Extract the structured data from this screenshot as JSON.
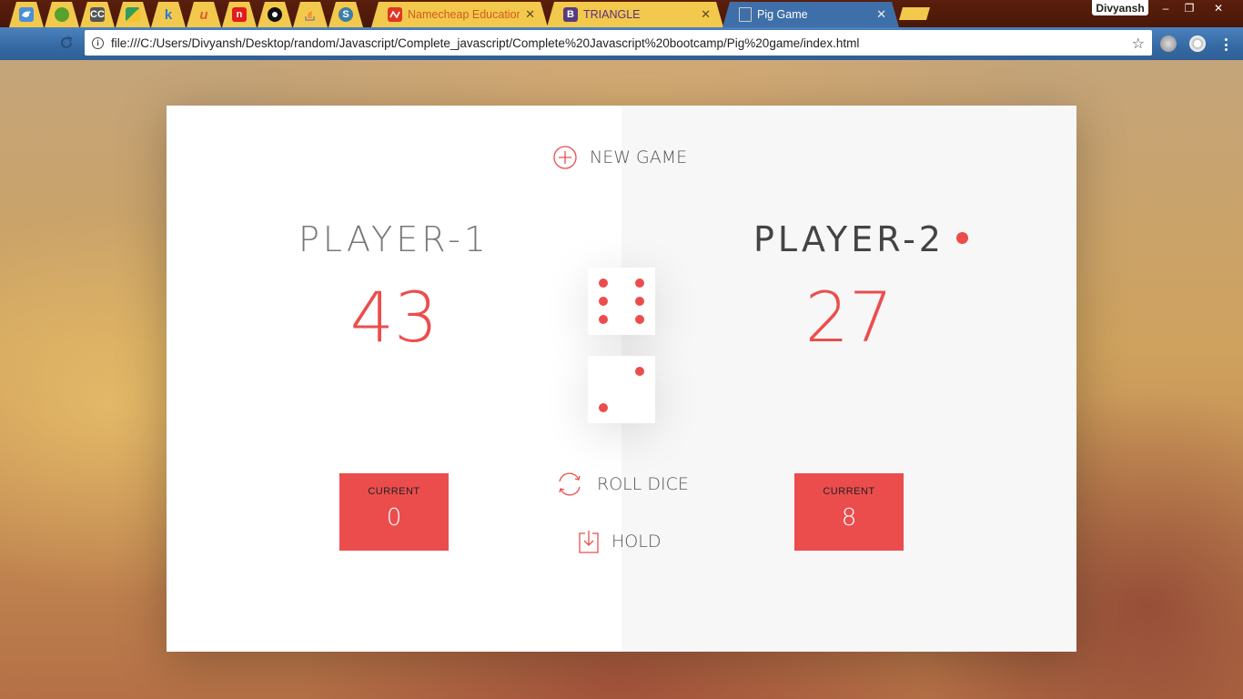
{
  "browser": {
    "tabs": [
      {
        "icon": "bird-icon",
        "color": "#4a90d9",
        "label": ""
      },
      {
        "icon": "cube-icon",
        "color": "#5aa02c",
        "label": ""
      },
      {
        "icon": "cc-icon",
        "color": "#555555",
        "label": "CC"
      },
      {
        "icon": "drive-icon",
        "color": "#2f9e5c",
        "label": ""
      },
      {
        "icon": "k-icon",
        "color": "#2a7bd8",
        "label": "k"
      },
      {
        "icon": "u-icon",
        "color": "#e25b2c",
        "label": "u"
      },
      {
        "icon": "n-icon",
        "color": "#e21b1b",
        "label": "n"
      },
      {
        "icon": "github-icon",
        "color": "#111111",
        "label": ""
      },
      {
        "icon": "stackoverflow-icon",
        "color": "#f48024",
        "label": ""
      },
      {
        "icon": "s-icon",
        "color": "#3b7ea8",
        "label": "S"
      },
      {
        "icon": "namecheap-icon",
        "color": "#de3723",
        "label": "Namecheap Education P"
      },
      {
        "icon": "bootstrap-icon",
        "color": "#563d7c",
        "label": "TRIANGLE"
      },
      {
        "icon": "page-icon",
        "color": "#dddddd",
        "label": "Pig Game"
      }
    ],
    "profile_name": "Divyansh",
    "window_buttons": [
      "–",
      "❐",
      "✕"
    ],
    "url": "file:///C:/Users/Divyansh/Desktop/random/Javascript/Complete_javascript/Complete%20Javascript%20bootcamp/Pig%20game/index.html"
  },
  "game": {
    "new_game_label": "NEW GAME",
    "roll_dice_label": "ROLL DICE",
    "hold_label": "HOLD",
    "accent_color": "#eb4d4d",
    "players": [
      {
        "name": "PLAYER-1",
        "score": "43",
        "current_label": "CURRENT",
        "current": "0",
        "active": false
      },
      {
        "name": "PLAYER-2",
        "score": "27",
        "current_label": "CURRENT",
        "current": "8",
        "active": true
      }
    ],
    "dice": [
      6,
      2
    ]
  }
}
